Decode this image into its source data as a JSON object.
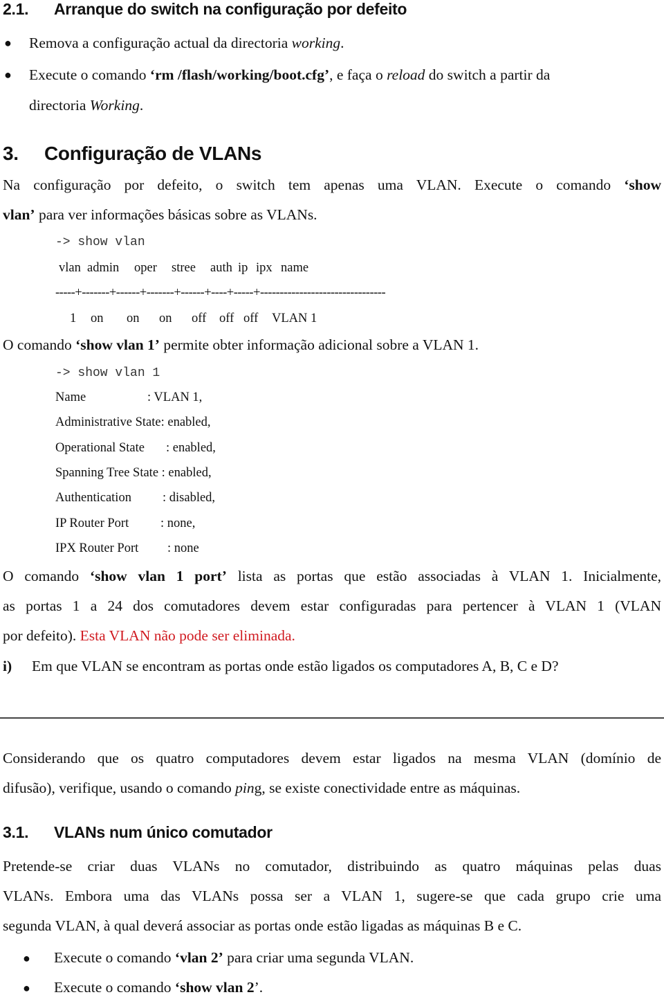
{
  "section_2_1": {
    "number": "2.1.",
    "title": "Arranque do switch na configuração por defeito",
    "bullets": [
      {
        "pre": "Remova a configuração actual da directoria ",
        "italic": "working",
        "post": "."
      },
      {
        "pre": "Execute o comando ",
        "bold": "‘rm /flash/working/boot.cfg’",
        "mid": ", e faça o ",
        "italic": "reload",
        "post": " do switch a partir da",
        "line2_pre": "directoria ",
        "line2_italic": "Working",
        "line2_post": "."
      }
    ]
  },
  "section_3": {
    "number": "3.",
    "title": "Configuração de VLANs",
    "intro_line1_pre": "Na configuração por defeito, o switch tem apenas uma VLAN. Execute o comando ",
    "intro_line1_bold": "‘show",
    "intro_line2_bold": "vlan’",
    "intro_line2_post": " para ver informações básicas sobre as VLANs.",
    "cmd1": "-> show vlan",
    "table_header": [
      "vlan",
      "admin",
      "oper",
      "stree",
      "auth",
      "ip",
      "ipx",
      "name"
    ],
    "table_separator": "-----+-------+------+-------+------+----+-----+--------------------------------",
    "table_row": [
      "1",
      "on",
      "on",
      "on",
      "off",
      "off",
      "off",
      "VLAN 1"
    ],
    "para2_pre": "O comando ",
    "para2_bold": "‘show vlan 1’",
    "para2_post": " permite obter informação adicional sobre a VLAN 1.",
    "cmd2": "-> show vlan 1",
    "vlan1_details": [
      {
        "label": "Name",
        "value": ": VLAN 1,"
      },
      {
        "label": "Administrative State",
        "value": ": enabled,"
      },
      {
        "label": "Operational State",
        "value": ": enabled,"
      },
      {
        "label": "Spanning Tree State",
        "value": ": enabled,"
      },
      {
        "label": "Authentication",
        "value": ": disabled,"
      },
      {
        "label": "IP Router Port",
        "value": ": none,"
      },
      {
        "label": "IPX Router Port",
        "value": ": none"
      }
    ],
    "para3_line1_pre": "O comando ",
    "para3_line1_bold": "‘show vlan 1 port’",
    "para3_line1_post": " lista as portas que estão associadas à VLAN 1. Inicialmente,",
    "para3_line2": "as portas 1 a 24 dos comutadores devem estar configuradas para pertencer à VLAN 1 (VLAN",
    "para3_line3_pre": "por defeito). ",
    "para3_line3_red": "Esta VLAN não pode ser eliminada.",
    "question_label": "i)",
    "question_text": "Em que VLAN se encontram as portas onde estão ligados os computadores A, B, C e D?",
    "para4_line1": "Considerando que os quatro computadores devem estar ligados na mesma VLAN (domínio de",
    "para4_line2_pre": "difusão), verifique, usando o comando ",
    "para4_line2_italic": "pin",
    "para4_line2_post": "g, se existe conectividade entre as máquinas."
  },
  "section_3_1": {
    "number": "3.1.",
    "title": "VLANs num único comutador",
    "para_line1": "Pretende-se criar duas VLANs no comutador, distribuindo as quatro máquinas pelas duas",
    "para_line2": "VLANs. Embora uma das VLANs possa ser a VLAN 1, sugere-se que cada grupo crie uma",
    "para_line3": "segunda VLAN, à qual deverá associar as portas onde estão ligadas as máquinas B e C.",
    "bullets": [
      {
        "pre": "Execute o comando ",
        "bold": "‘vlan 2’",
        "post": " para criar uma segunda VLAN."
      },
      {
        "pre": "Execute o comando ",
        "bold": "‘show vlan 2",
        "post": "’."
      }
    ]
  },
  "colors": {
    "highlight_red": "#d01a20",
    "rule": "#444444"
  }
}
